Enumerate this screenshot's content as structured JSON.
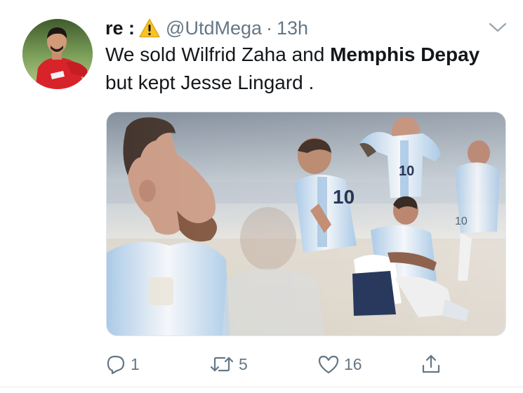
{
  "tweet": {
    "display_name": "re :",
    "display_name_emoji": "warning-emoji",
    "handle": "@UtdMega",
    "separator": "·",
    "time": "13h",
    "text_parts": {
      "p1": "We sold Wilfrid Zaha and ",
      "p2": "Memphis Depay",
      "p3": " but kept  Jesse Lingard  ."
    },
    "media_alt_icon": "photo-collage",
    "jersey_numbers": [
      "10",
      "10",
      "10"
    ]
  },
  "actions": {
    "reply_count": "1",
    "retweet_count": "5",
    "like_count": "16"
  },
  "colors": {
    "text_primary": "#14171a",
    "text_secondary": "#657786",
    "divider": "#e6ecf0",
    "warning_yellow": "#f7c325"
  }
}
